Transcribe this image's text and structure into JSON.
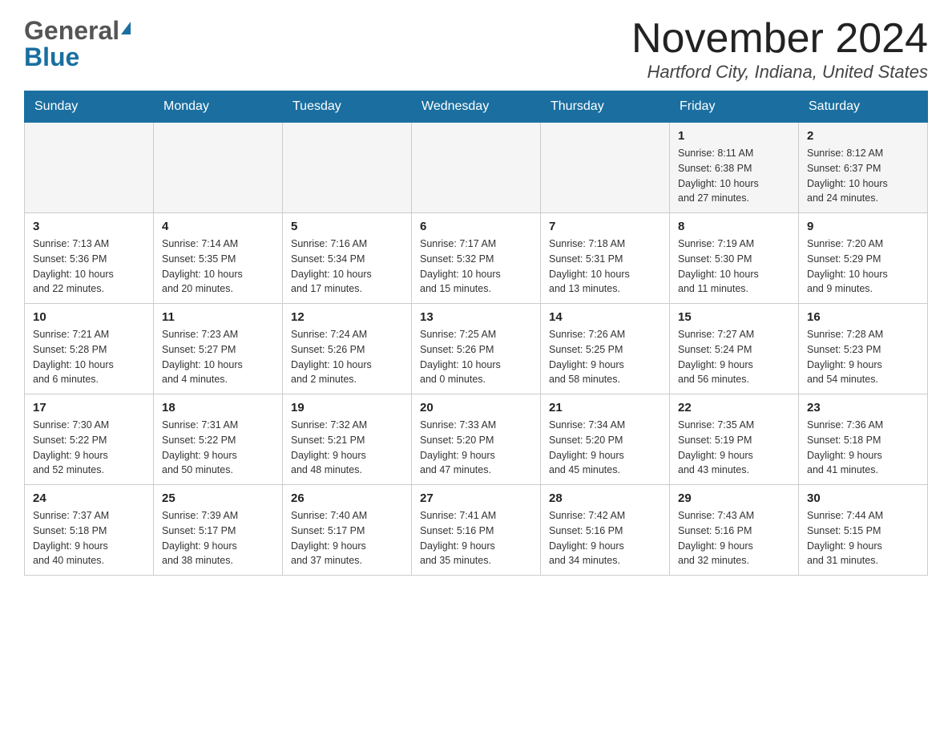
{
  "header": {
    "logo_line1": "General",
    "logo_line2": "Blue",
    "month": "November 2024",
    "location": "Hartford City, Indiana, United States"
  },
  "days_of_week": [
    "Sunday",
    "Monday",
    "Tuesday",
    "Wednesday",
    "Thursday",
    "Friday",
    "Saturday"
  ],
  "weeks": [
    [
      {
        "day": "",
        "info": ""
      },
      {
        "day": "",
        "info": ""
      },
      {
        "day": "",
        "info": ""
      },
      {
        "day": "",
        "info": ""
      },
      {
        "day": "",
        "info": ""
      },
      {
        "day": "1",
        "info": "Sunrise: 8:11 AM\nSunset: 6:38 PM\nDaylight: 10 hours\nand 27 minutes."
      },
      {
        "day": "2",
        "info": "Sunrise: 8:12 AM\nSunset: 6:37 PM\nDaylight: 10 hours\nand 24 minutes."
      }
    ],
    [
      {
        "day": "3",
        "info": "Sunrise: 7:13 AM\nSunset: 5:36 PM\nDaylight: 10 hours\nand 22 minutes."
      },
      {
        "day": "4",
        "info": "Sunrise: 7:14 AM\nSunset: 5:35 PM\nDaylight: 10 hours\nand 20 minutes."
      },
      {
        "day": "5",
        "info": "Sunrise: 7:16 AM\nSunset: 5:34 PM\nDaylight: 10 hours\nand 17 minutes."
      },
      {
        "day": "6",
        "info": "Sunrise: 7:17 AM\nSunset: 5:32 PM\nDaylight: 10 hours\nand 15 minutes."
      },
      {
        "day": "7",
        "info": "Sunrise: 7:18 AM\nSunset: 5:31 PM\nDaylight: 10 hours\nand 13 minutes."
      },
      {
        "day": "8",
        "info": "Sunrise: 7:19 AM\nSunset: 5:30 PM\nDaylight: 10 hours\nand 11 minutes."
      },
      {
        "day": "9",
        "info": "Sunrise: 7:20 AM\nSunset: 5:29 PM\nDaylight: 10 hours\nand 9 minutes."
      }
    ],
    [
      {
        "day": "10",
        "info": "Sunrise: 7:21 AM\nSunset: 5:28 PM\nDaylight: 10 hours\nand 6 minutes."
      },
      {
        "day": "11",
        "info": "Sunrise: 7:23 AM\nSunset: 5:27 PM\nDaylight: 10 hours\nand 4 minutes."
      },
      {
        "day": "12",
        "info": "Sunrise: 7:24 AM\nSunset: 5:26 PM\nDaylight: 10 hours\nand 2 minutes."
      },
      {
        "day": "13",
        "info": "Sunrise: 7:25 AM\nSunset: 5:26 PM\nDaylight: 10 hours\nand 0 minutes."
      },
      {
        "day": "14",
        "info": "Sunrise: 7:26 AM\nSunset: 5:25 PM\nDaylight: 9 hours\nand 58 minutes."
      },
      {
        "day": "15",
        "info": "Sunrise: 7:27 AM\nSunset: 5:24 PM\nDaylight: 9 hours\nand 56 minutes."
      },
      {
        "day": "16",
        "info": "Sunrise: 7:28 AM\nSunset: 5:23 PM\nDaylight: 9 hours\nand 54 minutes."
      }
    ],
    [
      {
        "day": "17",
        "info": "Sunrise: 7:30 AM\nSunset: 5:22 PM\nDaylight: 9 hours\nand 52 minutes."
      },
      {
        "day": "18",
        "info": "Sunrise: 7:31 AM\nSunset: 5:22 PM\nDaylight: 9 hours\nand 50 minutes."
      },
      {
        "day": "19",
        "info": "Sunrise: 7:32 AM\nSunset: 5:21 PM\nDaylight: 9 hours\nand 48 minutes."
      },
      {
        "day": "20",
        "info": "Sunrise: 7:33 AM\nSunset: 5:20 PM\nDaylight: 9 hours\nand 47 minutes."
      },
      {
        "day": "21",
        "info": "Sunrise: 7:34 AM\nSunset: 5:20 PM\nDaylight: 9 hours\nand 45 minutes."
      },
      {
        "day": "22",
        "info": "Sunrise: 7:35 AM\nSunset: 5:19 PM\nDaylight: 9 hours\nand 43 minutes."
      },
      {
        "day": "23",
        "info": "Sunrise: 7:36 AM\nSunset: 5:18 PM\nDaylight: 9 hours\nand 41 minutes."
      }
    ],
    [
      {
        "day": "24",
        "info": "Sunrise: 7:37 AM\nSunset: 5:18 PM\nDaylight: 9 hours\nand 40 minutes."
      },
      {
        "day": "25",
        "info": "Sunrise: 7:39 AM\nSunset: 5:17 PM\nDaylight: 9 hours\nand 38 minutes."
      },
      {
        "day": "26",
        "info": "Sunrise: 7:40 AM\nSunset: 5:17 PM\nDaylight: 9 hours\nand 37 minutes."
      },
      {
        "day": "27",
        "info": "Sunrise: 7:41 AM\nSunset: 5:16 PM\nDaylight: 9 hours\nand 35 minutes."
      },
      {
        "day": "28",
        "info": "Sunrise: 7:42 AM\nSunset: 5:16 PM\nDaylight: 9 hours\nand 34 minutes."
      },
      {
        "day": "29",
        "info": "Sunrise: 7:43 AM\nSunset: 5:16 PM\nDaylight: 9 hours\nand 32 minutes."
      },
      {
        "day": "30",
        "info": "Sunrise: 7:44 AM\nSunset: 5:15 PM\nDaylight: 9 hours\nand 31 minutes."
      }
    ]
  ]
}
